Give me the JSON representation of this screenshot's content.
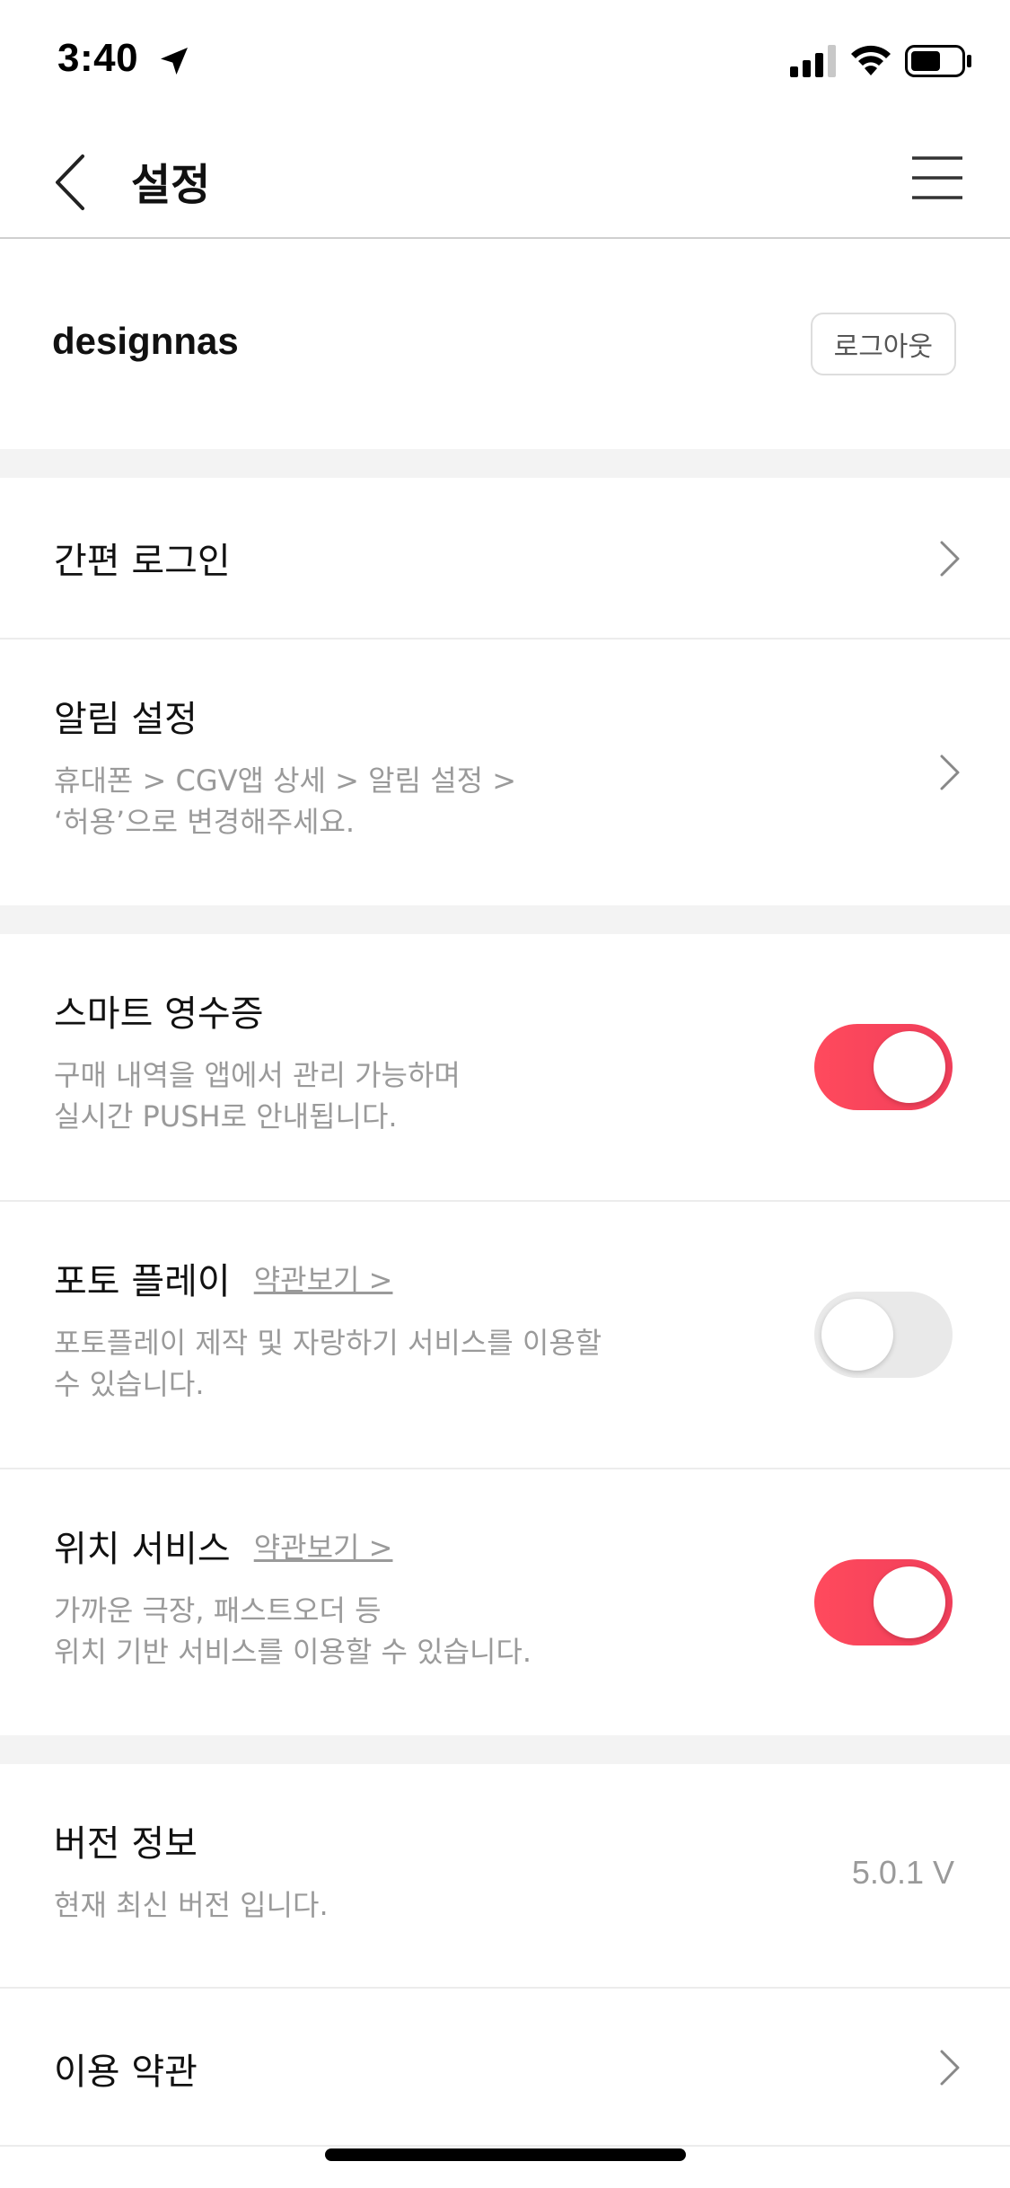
{
  "status_bar": {
    "time": "3:40"
  },
  "header": {
    "title": "설정"
  },
  "profile": {
    "username": "designnas",
    "logout_label": "로그아웃"
  },
  "rows": {
    "easy_login": {
      "title": "간편 로그인"
    },
    "notifications": {
      "title": "알림 설정",
      "desc": "휴대폰 > CGV앱 상세 > 알림 설정 >\n‘허용’으로 변경해주세요."
    },
    "smart_receipt": {
      "title": "스마트 영수증",
      "desc": "구매 내역을 앱에서 관리 가능하며\n실시간 PUSH로 안내됩니다.",
      "enabled": true
    },
    "photo_play": {
      "title": "포토 플레이",
      "terms_link": "약관보기 >",
      "desc": "포토플레이 제작 및 자랑하기 서비스를 이용할\n수 있습니다.",
      "enabled": false
    },
    "location": {
      "title": "위치 서비스",
      "terms_link": "약관보기 >",
      "desc": "가까운 극장, 패스트오더 등\n위치 기반 서비스를 이용할 수 있습니다.",
      "enabled": true
    },
    "version": {
      "title": "버전 정보",
      "desc": "현재 최신 버전 입니다.",
      "value": "5.0.1 V"
    },
    "terms": {
      "title": "이용 약관"
    }
  },
  "colors": {
    "toggle_on": "#ff4a5d",
    "toggle_off": "#e9e9e9",
    "secondary_text": "#9a9a9a"
  },
  "icons": {
    "back": "chevron-left-icon",
    "menu": "hamburger-menu-icon",
    "row_arrow": "chevron-right-icon"
  }
}
